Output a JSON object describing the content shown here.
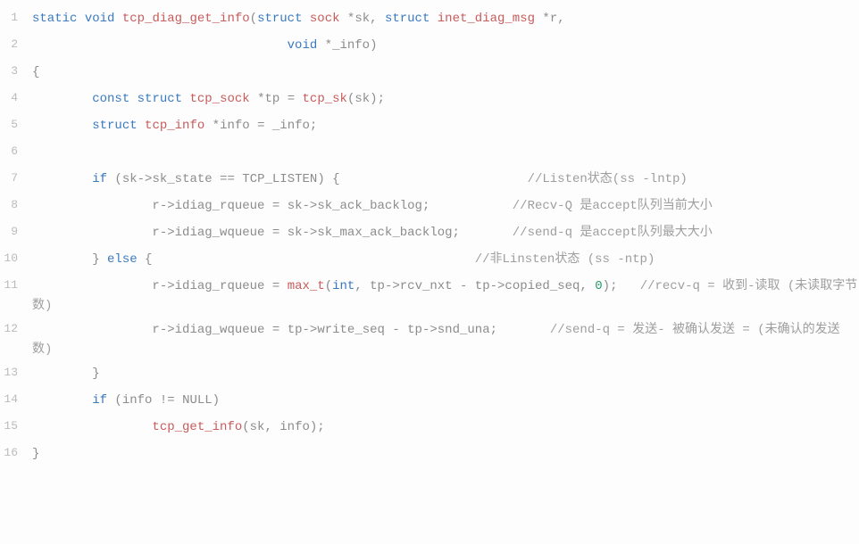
{
  "lines": [
    {
      "n": "1",
      "tokens": [
        {
          "t": "static",
          "c": "kw"
        },
        {
          "t": " ",
          "c": ""
        },
        {
          "t": "void",
          "c": "kw"
        },
        {
          "t": " ",
          "c": ""
        },
        {
          "t": "tcp_diag_get_info",
          "c": "fn"
        },
        {
          "t": "(",
          "c": "paren"
        },
        {
          "t": "struct",
          "c": "kw"
        },
        {
          "t": " ",
          "c": ""
        },
        {
          "t": "sock",
          "c": "fn"
        },
        {
          "t": " *",
          "c": "star"
        },
        {
          "t": "sk",
          "c": "id"
        },
        {
          "t": ", ",
          "c": "op"
        },
        {
          "t": "struct",
          "c": "kw"
        },
        {
          "t": " ",
          "c": ""
        },
        {
          "t": "inet_diag_msg",
          "c": "fn"
        },
        {
          "t": " *",
          "c": "star"
        },
        {
          "t": "r",
          "c": "id"
        },
        {
          "t": ",",
          "c": "op"
        }
      ]
    },
    {
      "n": "2",
      "tokens": [
        {
          "t": "                                  ",
          "c": ""
        },
        {
          "t": "void",
          "c": "kw"
        },
        {
          "t": " *",
          "c": "star"
        },
        {
          "t": "_info",
          "c": "id"
        },
        {
          "t": ")",
          "c": "paren"
        }
      ]
    },
    {
      "n": "3",
      "tokens": [
        {
          "t": "{",
          "c": "brace"
        }
      ]
    },
    {
      "n": "4",
      "tokens": [
        {
          "t": "        ",
          "c": ""
        },
        {
          "t": "const",
          "c": "kw"
        },
        {
          "t": " ",
          "c": ""
        },
        {
          "t": "struct",
          "c": "kw"
        },
        {
          "t": " ",
          "c": ""
        },
        {
          "t": "tcp_sock",
          "c": "fn"
        },
        {
          "t": " *",
          "c": "star"
        },
        {
          "t": "tp",
          "c": "id"
        },
        {
          "t": " = ",
          "c": "op"
        },
        {
          "t": "tcp_sk",
          "c": "fn"
        },
        {
          "t": "(",
          "c": "paren"
        },
        {
          "t": "sk",
          "c": "id"
        },
        {
          "t": ")",
          "c": "paren"
        },
        {
          "t": ";",
          "c": "semi"
        }
      ]
    },
    {
      "n": "5",
      "tokens": [
        {
          "t": "        ",
          "c": ""
        },
        {
          "t": "struct",
          "c": "kw"
        },
        {
          "t": " ",
          "c": ""
        },
        {
          "t": "tcp_info",
          "c": "fn"
        },
        {
          "t": " *",
          "c": "star"
        },
        {
          "t": "info",
          "c": "id"
        },
        {
          "t": " = ",
          "c": "op"
        },
        {
          "t": "_info",
          "c": "id"
        },
        {
          "t": ";",
          "c": "semi"
        }
      ]
    },
    {
      "n": "6",
      "tokens": [
        {
          "t": " ",
          "c": ""
        }
      ]
    },
    {
      "n": "7",
      "tokens": [
        {
          "t": "        ",
          "c": ""
        },
        {
          "t": "if",
          "c": "kw"
        },
        {
          "t": " (",
          "c": "paren"
        },
        {
          "t": "sk",
          "c": "id"
        },
        {
          "t": "->",
          "c": "op"
        },
        {
          "t": "sk_state",
          "c": "id"
        },
        {
          "t": " == ",
          "c": "op"
        },
        {
          "t": "TCP_LISTEN",
          "c": "id"
        },
        {
          "t": ") {",
          "c": "paren"
        },
        {
          "t": "                         ",
          "c": ""
        },
        {
          "t": "//Listen状态(ss -lntp)",
          "c": "cmt"
        }
      ]
    },
    {
      "n": "8",
      "tokens": [
        {
          "t": "                ",
          "c": ""
        },
        {
          "t": "r",
          "c": "id"
        },
        {
          "t": "->",
          "c": "op"
        },
        {
          "t": "idiag_rqueue",
          "c": "id"
        },
        {
          "t": " = ",
          "c": "op"
        },
        {
          "t": "sk",
          "c": "id"
        },
        {
          "t": "->",
          "c": "op"
        },
        {
          "t": "sk_ack_backlog",
          "c": "id"
        },
        {
          "t": ";",
          "c": "semi"
        },
        {
          "t": "           ",
          "c": ""
        },
        {
          "t": "//Recv-Q 是accept队列当前大小",
          "c": "cmt"
        }
      ]
    },
    {
      "n": "9",
      "tokens": [
        {
          "t": "                ",
          "c": ""
        },
        {
          "t": "r",
          "c": "id"
        },
        {
          "t": "->",
          "c": "op"
        },
        {
          "t": "idiag_wqueue",
          "c": "id"
        },
        {
          "t": " = ",
          "c": "op"
        },
        {
          "t": "sk",
          "c": "id"
        },
        {
          "t": "->",
          "c": "op"
        },
        {
          "t": "sk_max_ack_backlog",
          "c": "id"
        },
        {
          "t": ";",
          "c": "semi"
        },
        {
          "t": "       ",
          "c": ""
        },
        {
          "t": "//send-q 是accept队列最大大小",
          "c": "cmt"
        }
      ]
    },
    {
      "n": "10",
      "tokens": [
        {
          "t": "        } ",
          "c": "brace"
        },
        {
          "t": "else",
          "c": "kw"
        },
        {
          "t": " {",
          "c": "brace"
        },
        {
          "t": "                                           ",
          "c": ""
        },
        {
          "t": "//非Linsten状态 (ss -ntp)",
          "c": "cmt"
        }
      ]
    },
    {
      "n": "11",
      "tokens": [
        {
          "t": "                ",
          "c": ""
        },
        {
          "t": "r",
          "c": "id"
        },
        {
          "t": "->",
          "c": "op"
        },
        {
          "t": "idiag_rqueue",
          "c": "id"
        },
        {
          "t": " = ",
          "c": "op"
        },
        {
          "t": "max_t",
          "c": "fn"
        },
        {
          "t": "(",
          "c": "paren"
        },
        {
          "t": "int",
          "c": "kw"
        },
        {
          "t": ", ",
          "c": "op"
        },
        {
          "t": "tp",
          "c": "id"
        },
        {
          "t": "->",
          "c": "op"
        },
        {
          "t": "rcv_nxt",
          "c": "id"
        },
        {
          "t": " - ",
          "c": "op"
        },
        {
          "t": "tp",
          "c": "id"
        },
        {
          "t": "->",
          "c": "op"
        },
        {
          "t": "copied_seq",
          "c": "id"
        },
        {
          "t": ", ",
          "c": "op"
        },
        {
          "t": "0",
          "c": "num"
        },
        {
          "t": ")",
          "c": "paren"
        },
        {
          "t": ";",
          "c": "semi"
        },
        {
          "t": "   ",
          "c": ""
        },
        {
          "t": "//recv-q = 收到-读取 (未读取字节数)",
          "c": "cmt"
        }
      ]
    },
    {
      "n": "12",
      "tokens": [
        {
          "t": "                ",
          "c": ""
        },
        {
          "t": "r",
          "c": "id"
        },
        {
          "t": "->",
          "c": "op"
        },
        {
          "t": "idiag_wqueue",
          "c": "id"
        },
        {
          "t": " = ",
          "c": "op"
        },
        {
          "t": "tp",
          "c": "id"
        },
        {
          "t": "->",
          "c": "op"
        },
        {
          "t": "write_seq",
          "c": "id"
        },
        {
          "t": " - ",
          "c": "op"
        },
        {
          "t": "tp",
          "c": "id"
        },
        {
          "t": "->",
          "c": "op"
        },
        {
          "t": "snd_una",
          "c": "id"
        },
        {
          "t": ";",
          "c": "semi"
        },
        {
          "t": "       ",
          "c": ""
        },
        {
          "t": "//send-q = 发送- 被确认发送 = (未确认的发送数)",
          "c": "cmt"
        }
      ]
    },
    {
      "n": "13",
      "tokens": [
        {
          "t": "        }",
          "c": "brace"
        }
      ]
    },
    {
      "n": "14",
      "tokens": [
        {
          "t": "        ",
          "c": ""
        },
        {
          "t": "if",
          "c": "kw"
        },
        {
          "t": " (",
          "c": "paren"
        },
        {
          "t": "info",
          "c": "id"
        },
        {
          "t": " != ",
          "c": "op"
        },
        {
          "t": "NULL",
          "c": "id"
        },
        {
          "t": ")",
          "c": "paren"
        }
      ]
    },
    {
      "n": "15",
      "tokens": [
        {
          "t": "                ",
          "c": ""
        },
        {
          "t": "tcp_get_info",
          "c": "fn"
        },
        {
          "t": "(",
          "c": "paren"
        },
        {
          "t": "sk",
          "c": "id"
        },
        {
          "t": ", ",
          "c": "op"
        },
        {
          "t": "info",
          "c": "id"
        },
        {
          "t": ")",
          "c": "paren"
        },
        {
          "t": ";",
          "c": "semi"
        }
      ]
    },
    {
      "n": "16",
      "tokens": [
        {
          "t": "}",
          "c": "brace"
        }
      ]
    }
  ]
}
